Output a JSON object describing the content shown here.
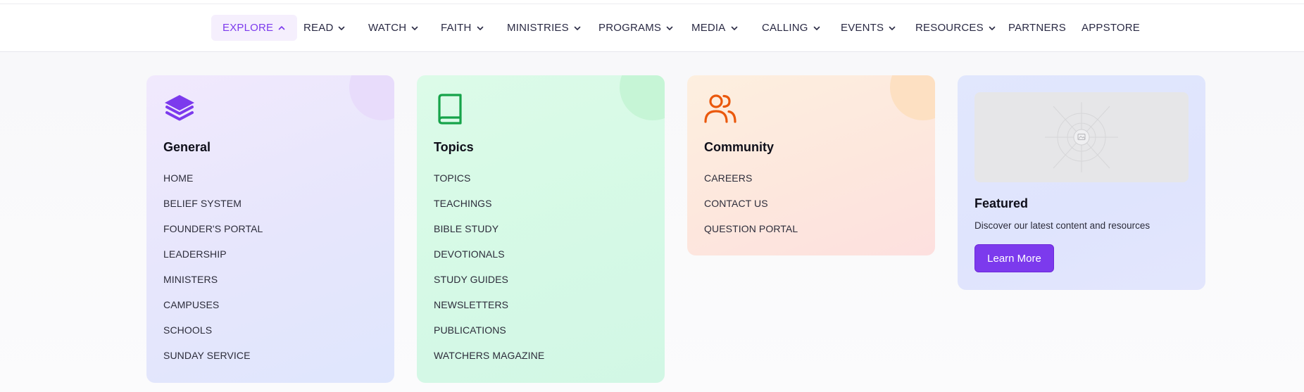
{
  "nav": {
    "items": [
      {
        "label": "EXPLORE",
        "has_chevron": true,
        "chevron": "up",
        "active": true
      },
      {
        "label": "READ",
        "has_chevron": true,
        "chevron": "down"
      },
      {
        "label": "WATCH",
        "has_chevron": true,
        "chevron": "down"
      },
      {
        "label": "FAITH",
        "has_chevron": true,
        "chevron": "down"
      },
      {
        "label": "MINISTRIES",
        "has_chevron": true,
        "chevron": "down"
      },
      {
        "label": "PROGRAMS",
        "has_chevron": true,
        "chevron": "down"
      },
      {
        "label": "MEDIA",
        "has_chevron": true,
        "chevron": "down"
      },
      {
        "label": "CALLING",
        "has_chevron": true,
        "chevron": "down"
      },
      {
        "label": "EVENTS",
        "has_chevron": true,
        "chevron": "down"
      },
      {
        "label": "RESOURCES",
        "has_chevron": true,
        "chevron": "down"
      },
      {
        "label": "PARTNERS",
        "has_chevron": false
      },
      {
        "label": "APPSTORE",
        "has_chevron": false
      }
    ]
  },
  "menu": {
    "general": {
      "icon": "layers-icon",
      "icon_color": "#7c3aed",
      "title": "General",
      "links": [
        "HOME",
        "BELIEF SYSTEM",
        "FOUNDER'S PORTAL",
        "LEADERSHIP",
        "MINISTERS",
        "CAMPUSES",
        "SCHOOLS",
        "SUNDAY SERVICE"
      ]
    },
    "topics": {
      "icon": "book-icon",
      "icon_color": "#16a34a",
      "title": "Topics",
      "links": [
        "TOPICS",
        "TEACHINGS",
        "BIBLE STUDY",
        "DEVOTIONALS",
        "STUDY GUIDES",
        "NEWSLETTERS",
        "PUBLICATIONS",
        "WATCHERS MAGAZINE"
      ]
    },
    "community": {
      "icon": "users-icon",
      "icon_color": "#ea580c",
      "title": "Community",
      "links": [
        "CAREERS",
        "CONTACT US",
        "QUESTION PORTAL"
      ]
    },
    "featured": {
      "image_icon": "image-placeholder-icon",
      "title": "Featured",
      "description": "Discover our latest content and resources",
      "button_label": "Learn More",
      "button_color": "#7c3aed"
    }
  },
  "colors": {
    "accent": "#7c3aed",
    "nav_text": "#2a2a44",
    "active_bg": "#f5effd"
  }
}
